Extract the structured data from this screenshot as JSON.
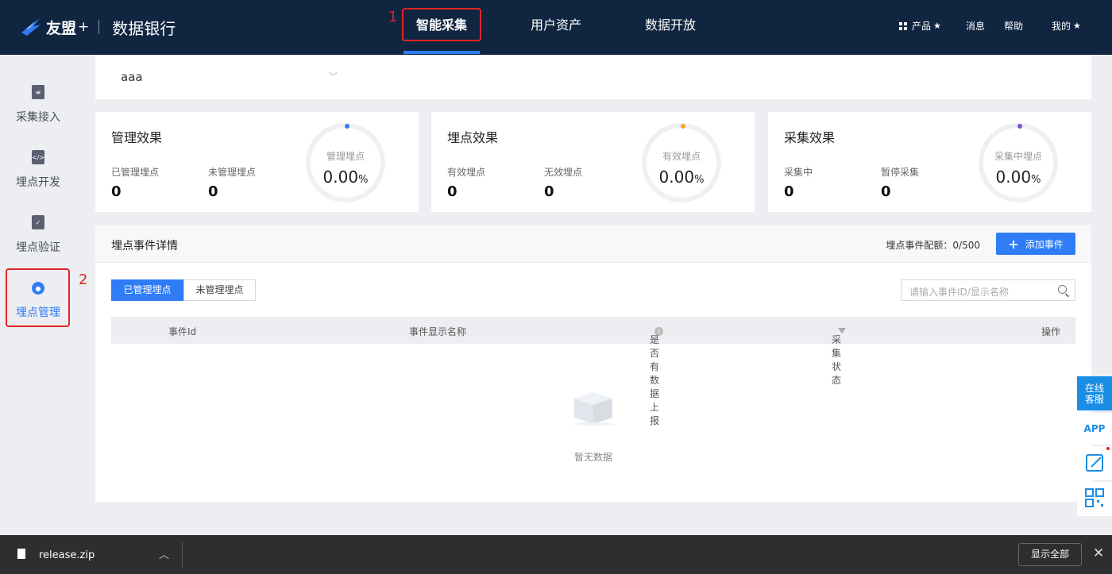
{
  "header": {
    "brand": "友盟",
    "brand_plus": "+",
    "product": "数据银行",
    "nav": [
      {
        "label": "智能采集"
      },
      {
        "label": "用户资产"
      },
      {
        "label": "数据开放"
      }
    ],
    "right": {
      "products": "产品",
      "messages": "消息",
      "help": "帮助",
      "mine": "我的"
    },
    "annotations": {
      "nav_marker": "1",
      "side_marker": "2"
    }
  },
  "sidebar": {
    "items": [
      {
        "label": "采集接入"
      },
      {
        "label": "埋点开发"
      },
      {
        "label": "埋点验证"
      },
      {
        "label": "埋点管理"
      }
    ]
  },
  "app_selector": {
    "value": "aaa"
  },
  "cards": [
    {
      "title": "管理效果",
      "m1_label": "已管理埋点",
      "m1_value": "0",
      "m2_label": "未管理埋点",
      "m2_value": "0",
      "ring_label": "管理埋点",
      "ring_value": "0.00",
      "ring_unit": "%",
      "dot_color": "#2f7cf6"
    },
    {
      "title": "埋点效果",
      "m1_label": "有效埋点",
      "m1_value": "0",
      "m2_label": "无效埋点",
      "m2_value": "0",
      "ring_label": "有效埋点",
      "ring_value": "0.00",
      "ring_unit": "%",
      "dot_color": "#f5a623"
    },
    {
      "title": "采集效果",
      "m1_label": "采集中",
      "m1_value": "0",
      "m2_label": "暂停采集",
      "m2_value": "0",
      "ring_label": "采集中埋点",
      "ring_value": "0.00",
      "ring_unit": "%",
      "dot_color": "#7b4fd6"
    }
  ],
  "events": {
    "title": "埋点事件详情",
    "quota": "埋点事件配额：0/500",
    "add_button": "添加事件",
    "tabs": [
      {
        "label": "已管理埋点"
      },
      {
        "label": "未管理埋点"
      }
    ],
    "search_placeholder": "请输入事件ID/显示名称",
    "columns": [
      "事件Id",
      "事件显示名称",
      "是否有数据上报",
      "采集状态",
      "操作"
    ],
    "empty_text": "暂无数据"
  },
  "float_tools": {
    "online_service": "在线\n客服",
    "app": "APP"
  },
  "download_bar": {
    "filename": "release.zip",
    "show_all": "显示全部"
  }
}
